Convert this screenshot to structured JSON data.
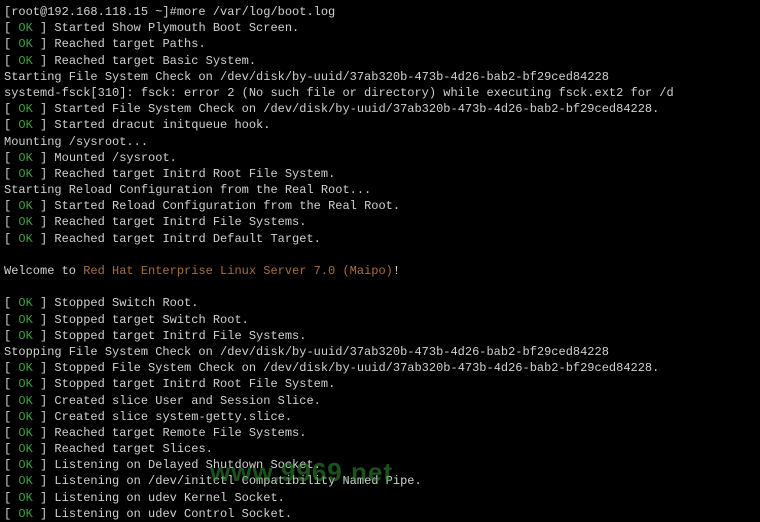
{
  "prompt": "[root@192.168.118.15 ~]#more /var/log/boot.log",
  "ok": "OK",
  "lb": "[  ",
  "rb": "  ] ",
  "lines": {
    "l1": "Started Show Plymouth Boot Screen.",
    "l2": "Reached target Paths.",
    "l3": "Reached target Basic System.",
    "l4": "         Starting File System Check on /dev/disk/by-uuid/37ab320b-473b-4d26-bab2-bf29ced84228",
    "l5": "systemd-fsck[310]: fsck: error 2 (No such file or directory) while executing fsck.ext2 for /d",
    "l6": "Started File System Check on /dev/disk/by-uuid/37ab320b-473b-4d26-bab2-bf29ced84228.",
    "l7": "Started dracut initqueue hook.",
    "l8": "         Mounting /sysroot...",
    "l9": "Mounted /sysroot.",
    "l10": "Reached target Initrd Root File System.",
    "l11": "         Starting Reload Configuration from the Real Root...",
    "l12": "Started Reload Configuration from the Real Root.",
    "l13": "Reached target Initrd File Systems.",
    "l14": "Reached target Initrd Default Target."
  },
  "welcome": {
    "prefix": "Welcome to ",
    "link": "Red Hat Enterprise Linux Server 7.0 (Maipo)",
    "suffix": "!"
  },
  "lines2": {
    "s1": "Stopped Switch Root.",
    "s2": "Stopped target Switch Root.",
    "s3": "Stopped target Initrd File Systems.",
    "s4": "         Stopping File System Check on /dev/disk/by-uuid/37ab320b-473b-4d26-bab2-bf29ced84228",
    "s5": "Stopped File System Check on /dev/disk/by-uuid/37ab320b-473b-4d26-bab2-bf29ced84228.",
    "s6": "Stopped target Initrd Root File System.",
    "s7": "Created slice User and Session Slice.",
    "s8": "Created slice system-getty.slice.",
    "s9": "Reached target Remote File Systems.",
    "s10": "Reached target Slices.",
    "s11": "Listening on Delayed Shutdown Socket.",
    "s12": "Listening on /dev/initctl Compatibility Named Pipe.",
    "s13": "Listening on udev Kernel Socket.",
    "s14": "Listening on udev Control Socket."
  },
  "watermark": "www.9969.net"
}
